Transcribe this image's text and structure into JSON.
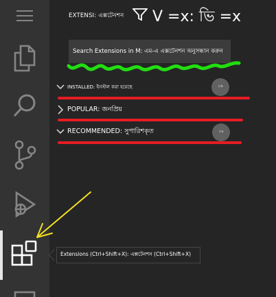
{
  "activity_bar": {
    "items": [
      {
        "icon": "hamburger-menu-icon"
      },
      {
        "icon": "explorer-files-icon"
      },
      {
        "icon": "search-icon"
      },
      {
        "icon": "source-control-icon"
      },
      {
        "icon": "run-debug-icon"
      },
      {
        "icon": "extensions-icon",
        "active": true
      },
      {
        "icon": "remote-explorer-icon"
      }
    ]
  },
  "sidebar": {
    "header_title": "EXTENSI: এক্সটেনশন",
    "header_overlay": "V =x: ভি =x",
    "filter_icon": "filter-icon",
    "search_placeholder": "Search Extensions in M: এম-এ এক্সটেনশন অনুসন্ধান করুন",
    "sections": [
      {
        "label": "INSTALLED: ইনস্টল করা হয়েছে",
        "badge": "১৬",
        "expanded": true
      },
      {
        "label": "POPULAR: জনপ্রিয়",
        "badge": "",
        "expanded": false
      },
      {
        "label": "RECOMMENDED: সুপারিশকৃত",
        "badge": "১৯",
        "expanded": true
      }
    ]
  },
  "tooltip": {
    "text": "Extensions (Ctrl+Shift+X): এক্সটেনশন (Ctrl+Shift+X)"
  },
  "colors": {
    "activity_bar": "#333333",
    "sidebar": "#252526",
    "annotation_green": "#22dd11",
    "annotation_red": "#e51c23",
    "annotation_yellow": "#f5e21f"
  }
}
